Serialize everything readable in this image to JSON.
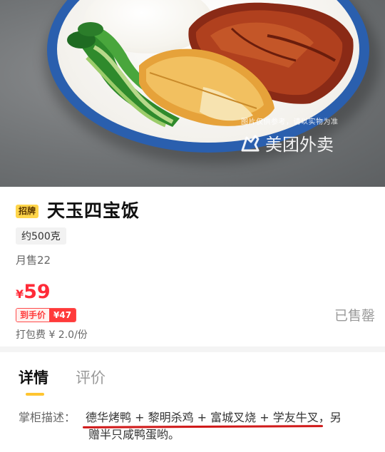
{
  "hero": {
    "watermark_note": "图片仅供参考，请以实物为准",
    "watermark_brand": "美团外卖",
    "watermark_icon": "kangaroo-logo-icon"
  },
  "product": {
    "badge": "招牌",
    "name": "天玉四宝饭",
    "weight": "约500克",
    "monthly_sales": "月售22",
    "price_currency": "¥",
    "price_value": "59",
    "deal_label": "到手价",
    "deal_price": "¥47",
    "packing_fee": "打包费 ¥ 2.0/份",
    "status": "已售罄"
  },
  "tabs": [
    {
      "label": "详情"
    },
    {
      "label": "评价"
    }
  ],
  "description": {
    "label": "掌柜描述：",
    "highlight": "德华烤鸭 + 黎明杀鸡 + 富城叉烧 + 学友牛叉",
    "tail_line1": "，另",
    "line2": "赠半只咸鸭蛋哟。"
  },
  "colors": {
    "price_red": "#ff2b38",
    "badge_yellow": "#ffd54a",
    "tab_accent": "#ffc530",
    "underline_red": "#d01818"
  }
}
